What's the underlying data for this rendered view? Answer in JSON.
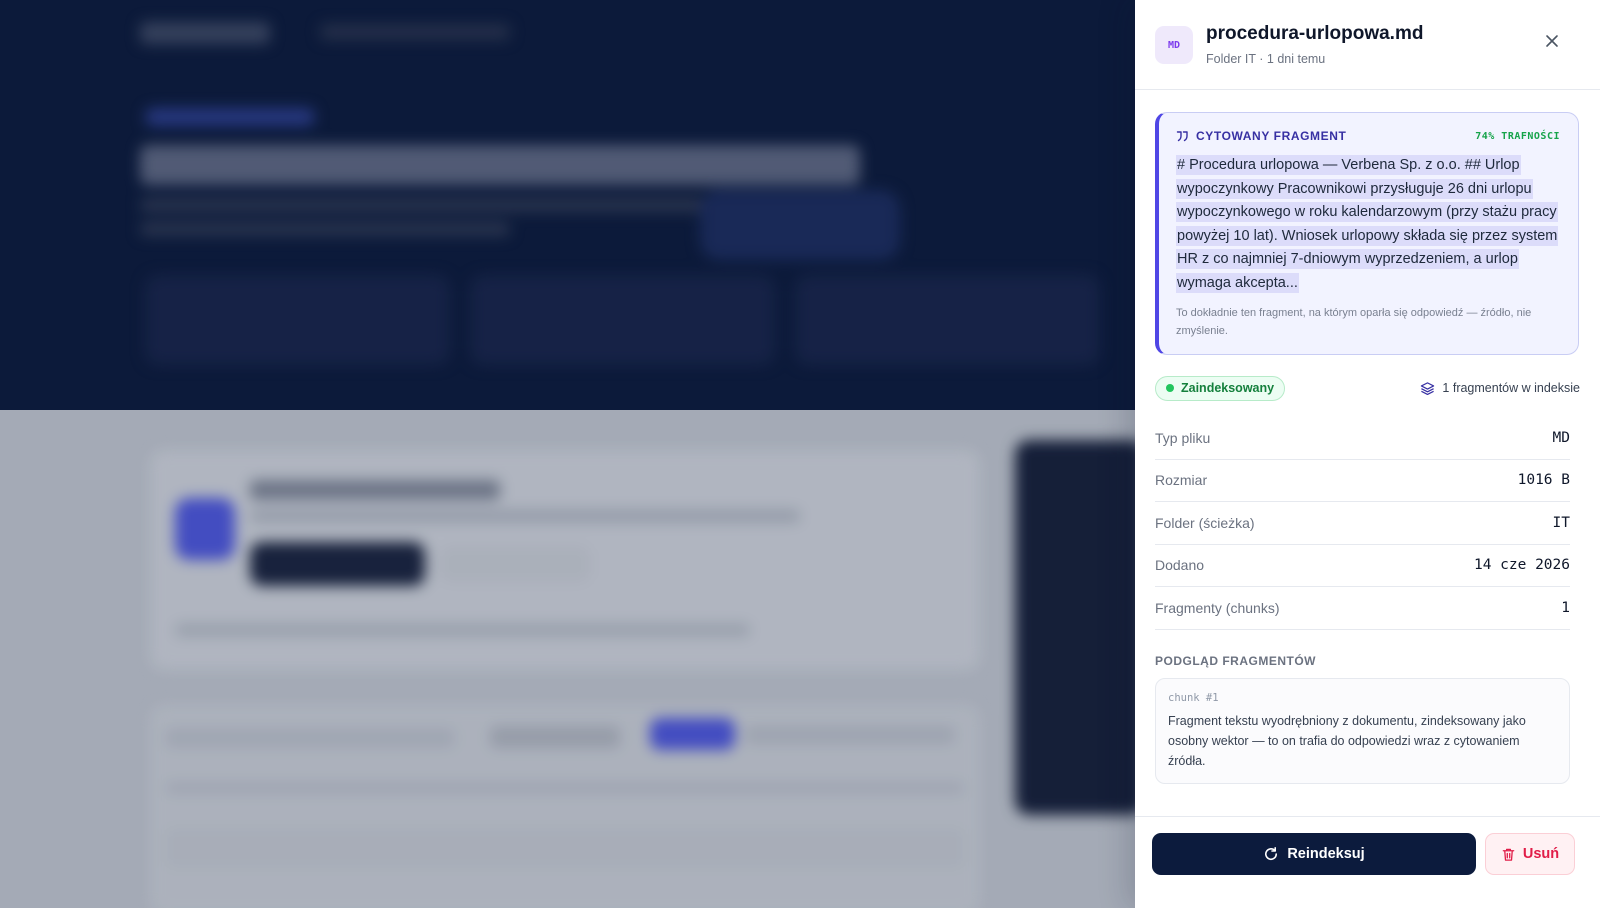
{
  "drawer": {
    "file_badge": "MD",
    "file_name": "procedura-urlopowa.md",
    "file_subtitle": "Folder IT · 1 dni temu",
    "quote": {
      "label": "CYTOWANY FRAGMENT",
      "match": "74% TRAFNOŚCI",
      "text": "# Procedura urlopowa — Verbena Sp. z o.o. ## Urlop wypoczynkowy Pracownikowi przysługuje 26 dni urlopu wypoczynkowego w roku kalendarzowym (przy stażu pracy powyżej 10 lat). Wniosek urlopowy składa się przez system HR z co najmniej 7-dniowym wyprzedzeniem, a urlop wymaga akcepta...",
      "note": "To dokładnie ten fragment, na którym oparła się odpowiedź — źródło, nie zmyślenie."
    },
    "status": {
      "label": "Zaindeksowany",
      "chunks": "1 fragmentów w indeksie"
    },
    "meta": [
      {
        "label": "Typ pliku",
        "value": "MD"
      },
      {
        "label": "Rozmiar",
        "value": "1016 B"
      },
      {
        "label": "Folder (ścieżka)",
        "value": "IT"
      },
      {
        "label": "Dodano",
        "value": "14 cze 2026"
      },
      {
        "label": "Fragmenty (chunks)",
        "value": "1"
      }
    ],
    "preview": {
      "title": "PODGLĄD FRAGMENTÓW",
      "chunk_tag": "chunk #1",
      "chunk_text": "Fragment tekstu wyodrębniony z dokumentu, zindeksowany jako osobny wektor — to on trafia do odpowiedzi wraz z cytowaniem źródła."
    },
    "actions": {
      "reindex": "Reindeksuj",
      "delete": "Usuń"
    },
    "colors": {
      "primary": "#0c1b3d",
      "accent": "#4f46e5",
      "success": "#16a34a",
      "danger": "#e11d48"
    }
  }
}
